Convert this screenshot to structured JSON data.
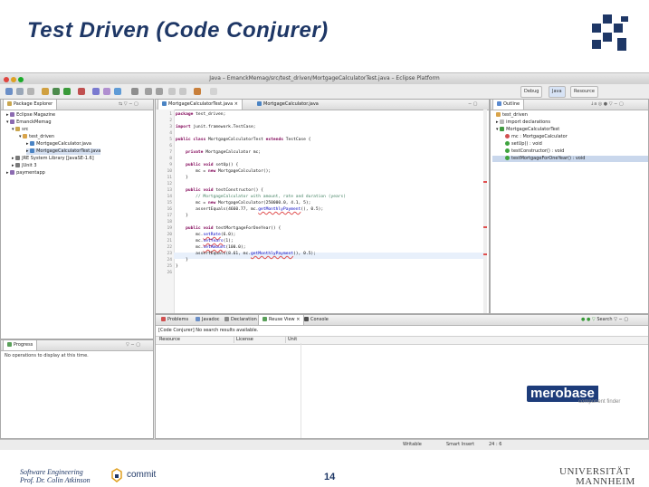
{
  "slide": {
    "title": "Test Driven (Code Conjurer)",
    "footer_line1": "Software Engineering",
    "footer_line2": "Prof. Dr. Colin Atkinson",
    "page_number": "14",
    "university_line1": "UNIVERSITÄT",
    "university_line2": "MANNHEIM",
    "commit_logo": "commit"
  },
  "window": {
    "title": "Java – EmanckMemag/src/test_driven/MortgageCalculatorTest.java – Eclipse Platform",
    "perspectives": [
      "Debug",
      "Java",
      "Resource"
    ]
  },
  "package_explorer": {
    "tab": "Package Explorer",
    "items": [
      "Eclipse Magazine",
      "EmanckMemag",
      "src",
      "test_driven",
      "MortgageCalculator.java",
      "MortgageCalculatorTest.java",
      "JRE System Library [JavaSE-1.6]",
      "JUnit 3",
      "paymentapp"
    ]
  },
  "editor": {
    "tabs": [
      "MortgageCalculatorTest.java",
      "MortgageCalculator.java"
    ],
    "lines": [
      "package test_driven;",
      "",
      "import junit.framework.TestCase;",
      "",
      "public class MortgageCalculatorTest extends TestCase {",
      "",
      "    private MortgageCalculator mc;",
      "",
      "    public void setUp() {",
      "        mc = new MortgageCalculator();",
      "    }",
      "",
      "    public void testConstructor() {",
      "        // MortgageCalculator with amount, rate and duration (years)",
      "        mc = new MortgageCalculator(250000.0, 4.1, 5);",
      "        assertEquals(4660.77, mc.getMonthlyPayment(), 0.5);",
      "    }",
      "",
      "    public void testMortgageForOneYear() {",
      "        mc.setRate(6.0);",
      "        mc.setYears(1);",
      "        mc.setAmount(100.0);",
      "        assertEquals(8.61, mc.getMonthlyPayment(), 0.5);",
      "    }",
      "}",
      ""
    ]
  },
  "outline": {
    "tab": "Outline",
    "items": [
      "test_driven",
      "import declarations",
      "MortgageCalculatorTest",
      "mc : MortgageCalculator",
      "setUp() : void",
      "testConstructor() : void",
      "testMortgageForOneYear() : void"
    ]
  },
  "console_panel": {
    "tabs": [
      "Problems",
      "Javadoc",
      "Declaration",
      "Reuse View",
      "Console"
    ],
    "search_label": "Search",
    "status": "[Code Conjurer] No search results available.",
    "columns": [
      "Resource",
      "License",
      "Unit"
    ],
    "merobase_brand": "merobase",
    "merobase_tagline": "component finder"
  },
  "progress": {
    "tab": "Progress",
    "message": "No operations to display at this time."
  },
  "statusbar": {
    "writable": "Writable",
    "insert_mode": "Smart Insert",
    "position": "24 : 6"
  },
  "colors": {
    "title_blue": "#1e3766",
    "keyword": "#7f0055",
    "comment": "#3f7f5f",
    "method": "#0000c0"
  }
}
